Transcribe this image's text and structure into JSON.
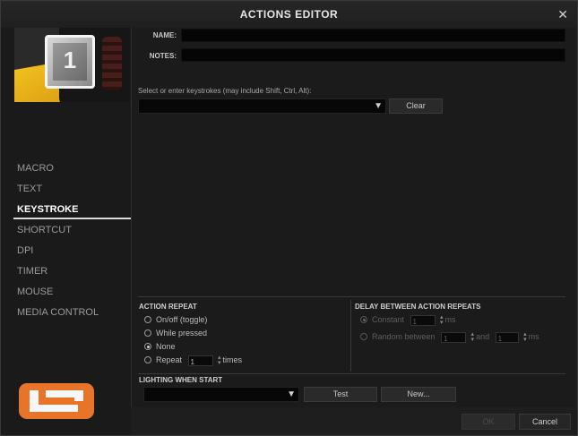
{
  "window": {
    "title": "ACTIONS EDITOR",
    "close_glyph": "✕"
  },
  "device": {
    "key_number": "1"
  },
  "nav": {
    "items": [
      {
        "label": "MACRO",
        "active": false
      },
      {
        "label": "TEXT",
        "active": false
      },
      {
        "label": "KEYSTROKE",
        "active": true
      },
      {
        "label": "SHORTCUT",
        "active": false
      },
      {
        "label": "DPI",
        "active": false
      },
      {
        "label": "TIMER",
        "active": false
      },
      {
        "label": "MOUSE",
        "active": false
      },
      {
        "label": "MEDIA CONTROL",
        "active": false
      }
    ]
  },
  "form": {
    "name_label": "NAME:",
    "name_value": "",
    "notes_label": "NOTES:",
    "notes_value": "",
    "keystroke_label": "Select or enter keystrokes (may include Shift, Ctrl, Alt):",
    "keystroke_value": "",
    "clear_label": "Clear"
  },
  "action_repeat": {
    "title": "ACTION REPEAT",
    "options": [
      {
        "label": "On/off (toggle)",
        "checked": false
      },
      {
        "label": "While pressed",
        "checked": false
      },
      {
        "label": "None",
        "checked": true
      },
      {
        "label": "Repeat",
        "checked": false
      }
    ],
    "repeat_count": "1",
    "repeat_unit": "times"
  },
  "delay": {
    "title": "DELAY BETWEEN ACTION REPEATS",
    "constant_label": "Constant",
    "constant_value": "1",
    "constant_unit": "ms",
    "random_label": "Random between",
    "random_min": "1",
    "random_and": "and",
    "random_max": "1",
    "random_unit": "ms"
  },
  "lighting": {
    "title": "LIGHTING WHEN START",
    "selected": "",
    "test_label": "Test",
    "new_label": "New..."
  },
  "footer": {
    "ok_label": "OK",
    "cancel_label": "Cancel"
  },
  "colors": {
    "logo_orange": "#e8742a",
    "background": "#1e1e1e"
  }
}
